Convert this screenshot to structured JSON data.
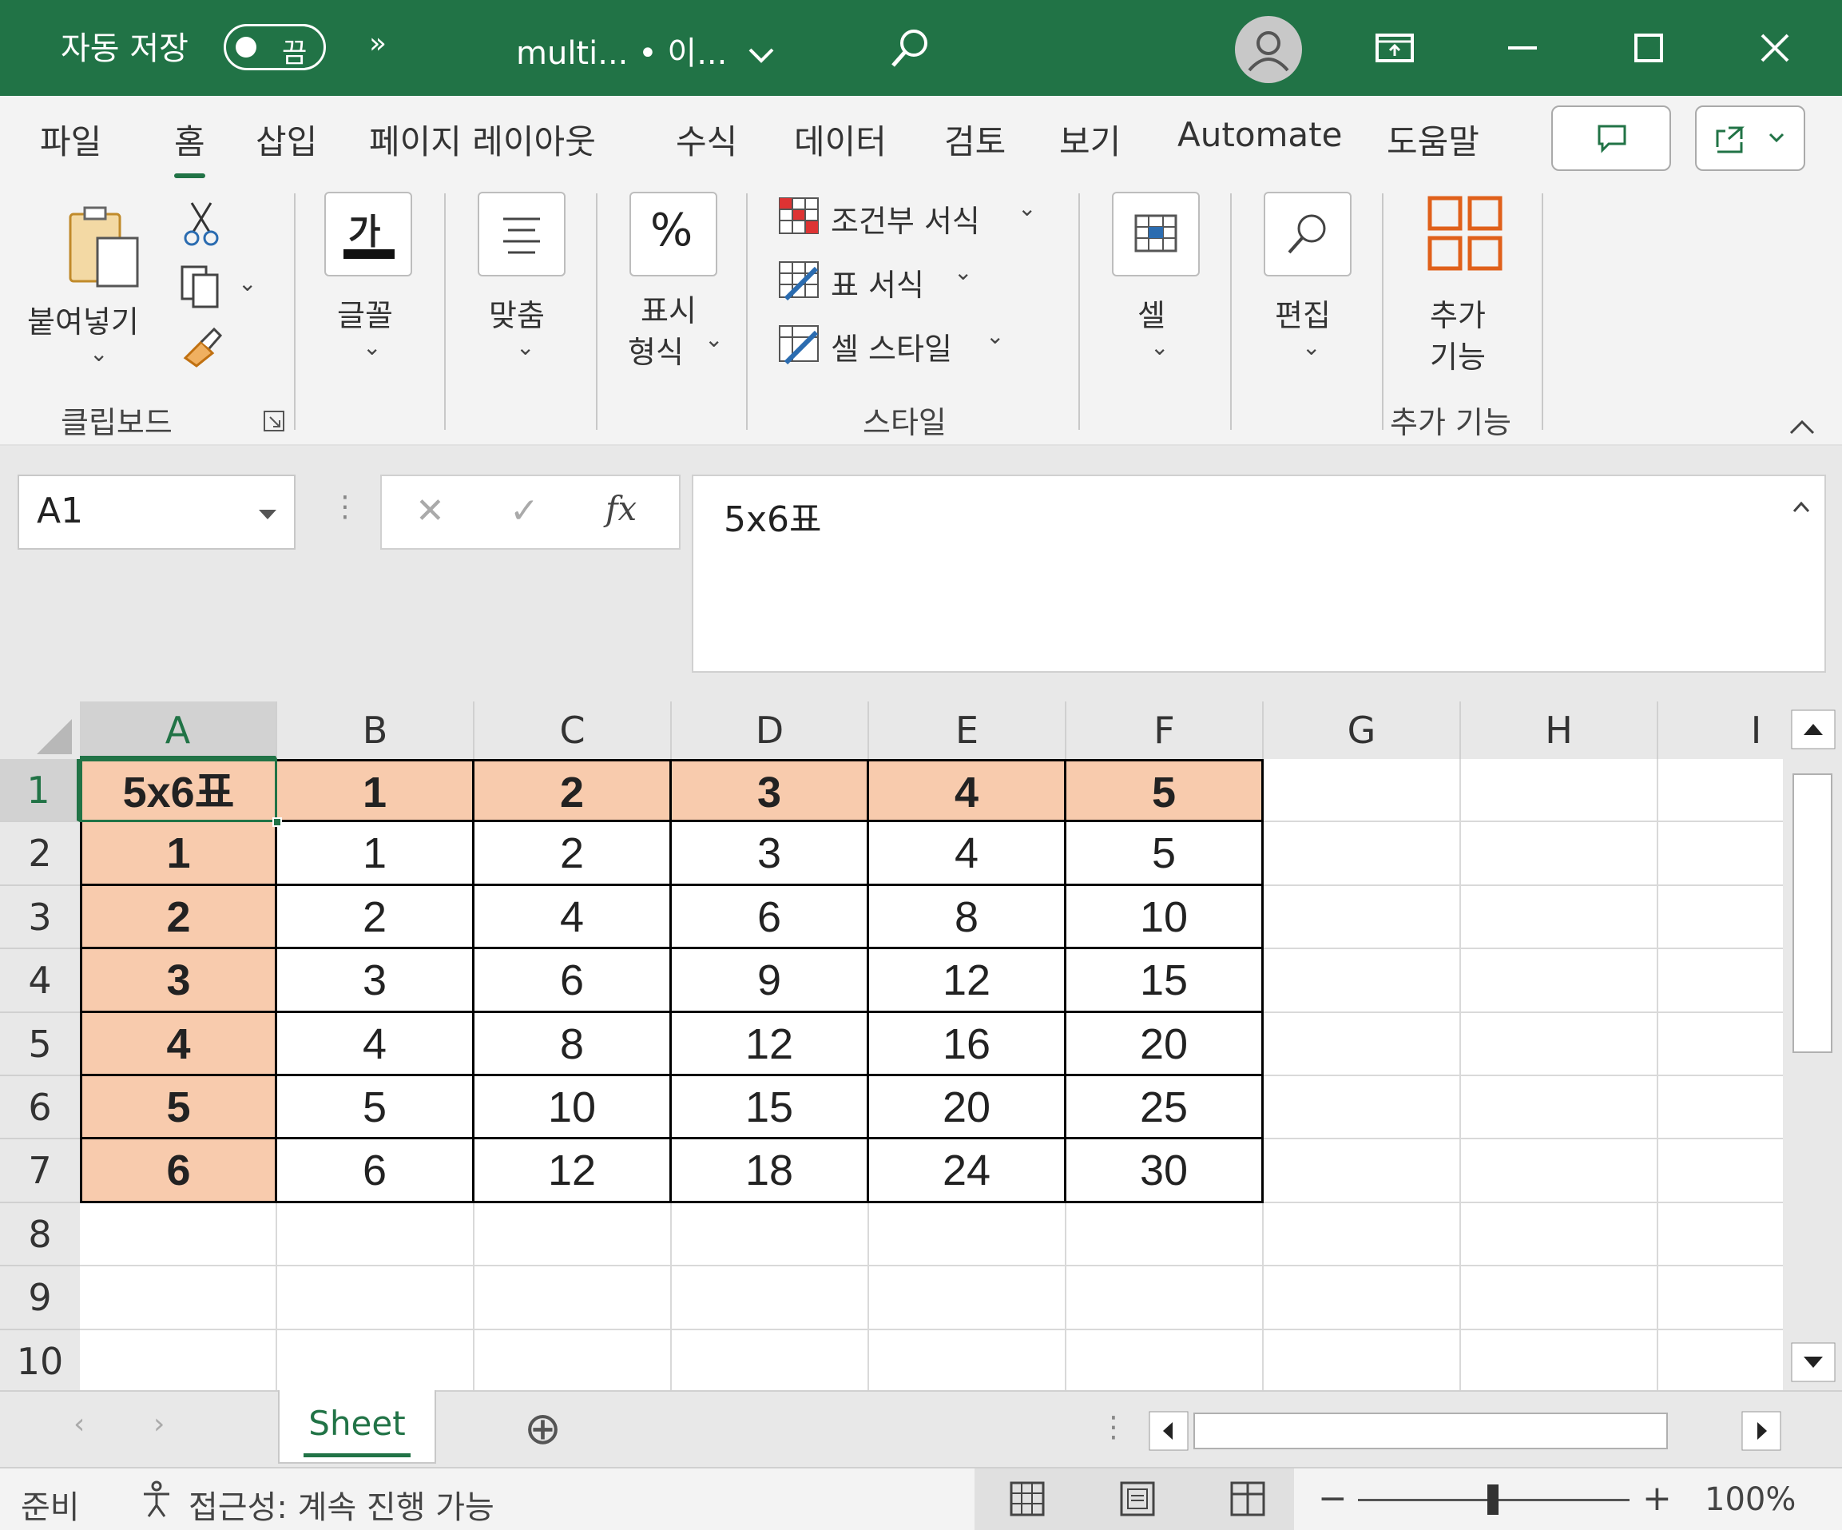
{
  "titlebar": {
    "autosave_label": "자동 저장",
    "autosave_state": "끔",
    "more": "»",
    "document_title": "multi... • 이...",
    "icons": [
      "search-icon",
      "account-icon",
      "ribbon-display-icon",
      "minimize-icon",
      "maximize-icon",
      "close-icon"
    ]
  },
  "ribbon": {
    "tabs": [
      "파일",
      "홈",
      "삽입",
      "페이지 레이아웃",
      "수식",
      "데이터",
      "검토",
      "보기",
      "Automate",
      "도움말"
    ],
    "active_tab": "홈",
    "clipboard": {
      "paste": "붙여넣기",
      "group": "클립보드"
    },
    "font": "글꼴",
    "font_glyph": "가",
    "alignment": "맞춤",
    "number": {
      "label1": "표시",
      "label2": "형식",
      "glyph": "%"
    },
    "styles": {
      "conditional": "조건부 서식",
      "table": "표 서식",
      "cell_style": "셀 스타일",
      "group": "스타일"
    },
    "cells": "셀",
    "editing": "편집",
    "addins": {
      "label1": "추가",
      "label2": "기능",
      "group": "추가 기능"
    }
  },
  "formula_bar": {
    "name_box": "A1",
    "content": "5x6표",
    "fx": "fx",
    "cancel": "✕",
    "enter": "✓"
  },
  "sheet": {
    "columns": [
      "A",
      "B",
      "C",
      "D",
      "E",
      "F",
      "G",
      "H",
      "I"
    ],
    "rows": [
      "1",
      "2",
      "3",
      "4",
      "5",
      "6",
      "7",
      "8",
      "9",
      "10"
    ],
    "selected_cell": "A1",
    "table": [
      [
        "5x6표",
        "1",
        "2",
        "3",
        "4",
        "5"
      ],
      [
        "1",
        "1",
        "2",
        "3",
        "4",
        "5"
      ],
      [
        "2",
        "2",
        "4",
        "6",
        "8",
        "10"
      ],
      [
        "3",
        "3",
        "6",
        "9",
        "12",
        "15"
      ],
      [
        "4",
        "4",
        "8",
        "12",
        "16",
        "20"
      ],
      [
        "5",
        "5",
        "10",
        "15",
        "20",
        "25"
      ],
      [
        "6",
        "6",
        "12",
        "18",
        "24",
        "30"
      ]
    ],
    "header_fill": "#f8cbad"
  },
  "sheet_tabs": {
    "active": "Sheet",
    "add": "⊕"
  },
  "status": {
    "ready": "준비",
    "accessibility": "접근성: 계속 진행 가능",
    "zoom": "100%",
    "zoom_minus": "−",
    "zoom_plus": "+"
  },
  "colors": {
    "brand": "#217346",
    "header_fill": "#f8cbad"
  }
}
